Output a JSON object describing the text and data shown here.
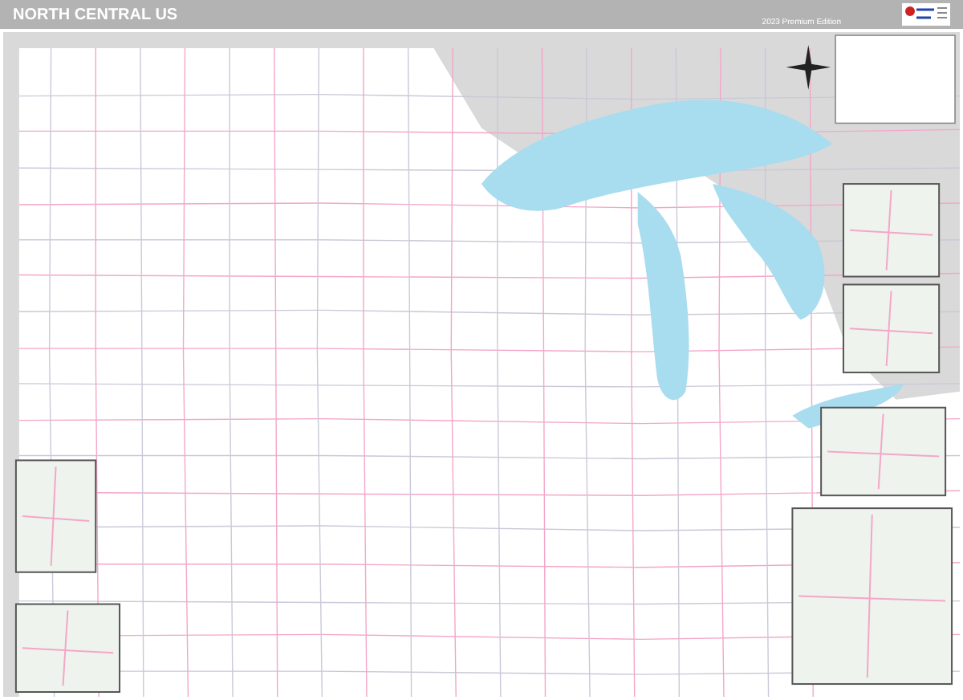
{
  "header": {
    "title": "NORTH CENTRAL US",
    "edition": "2023 Premium Edition"
  }
}
